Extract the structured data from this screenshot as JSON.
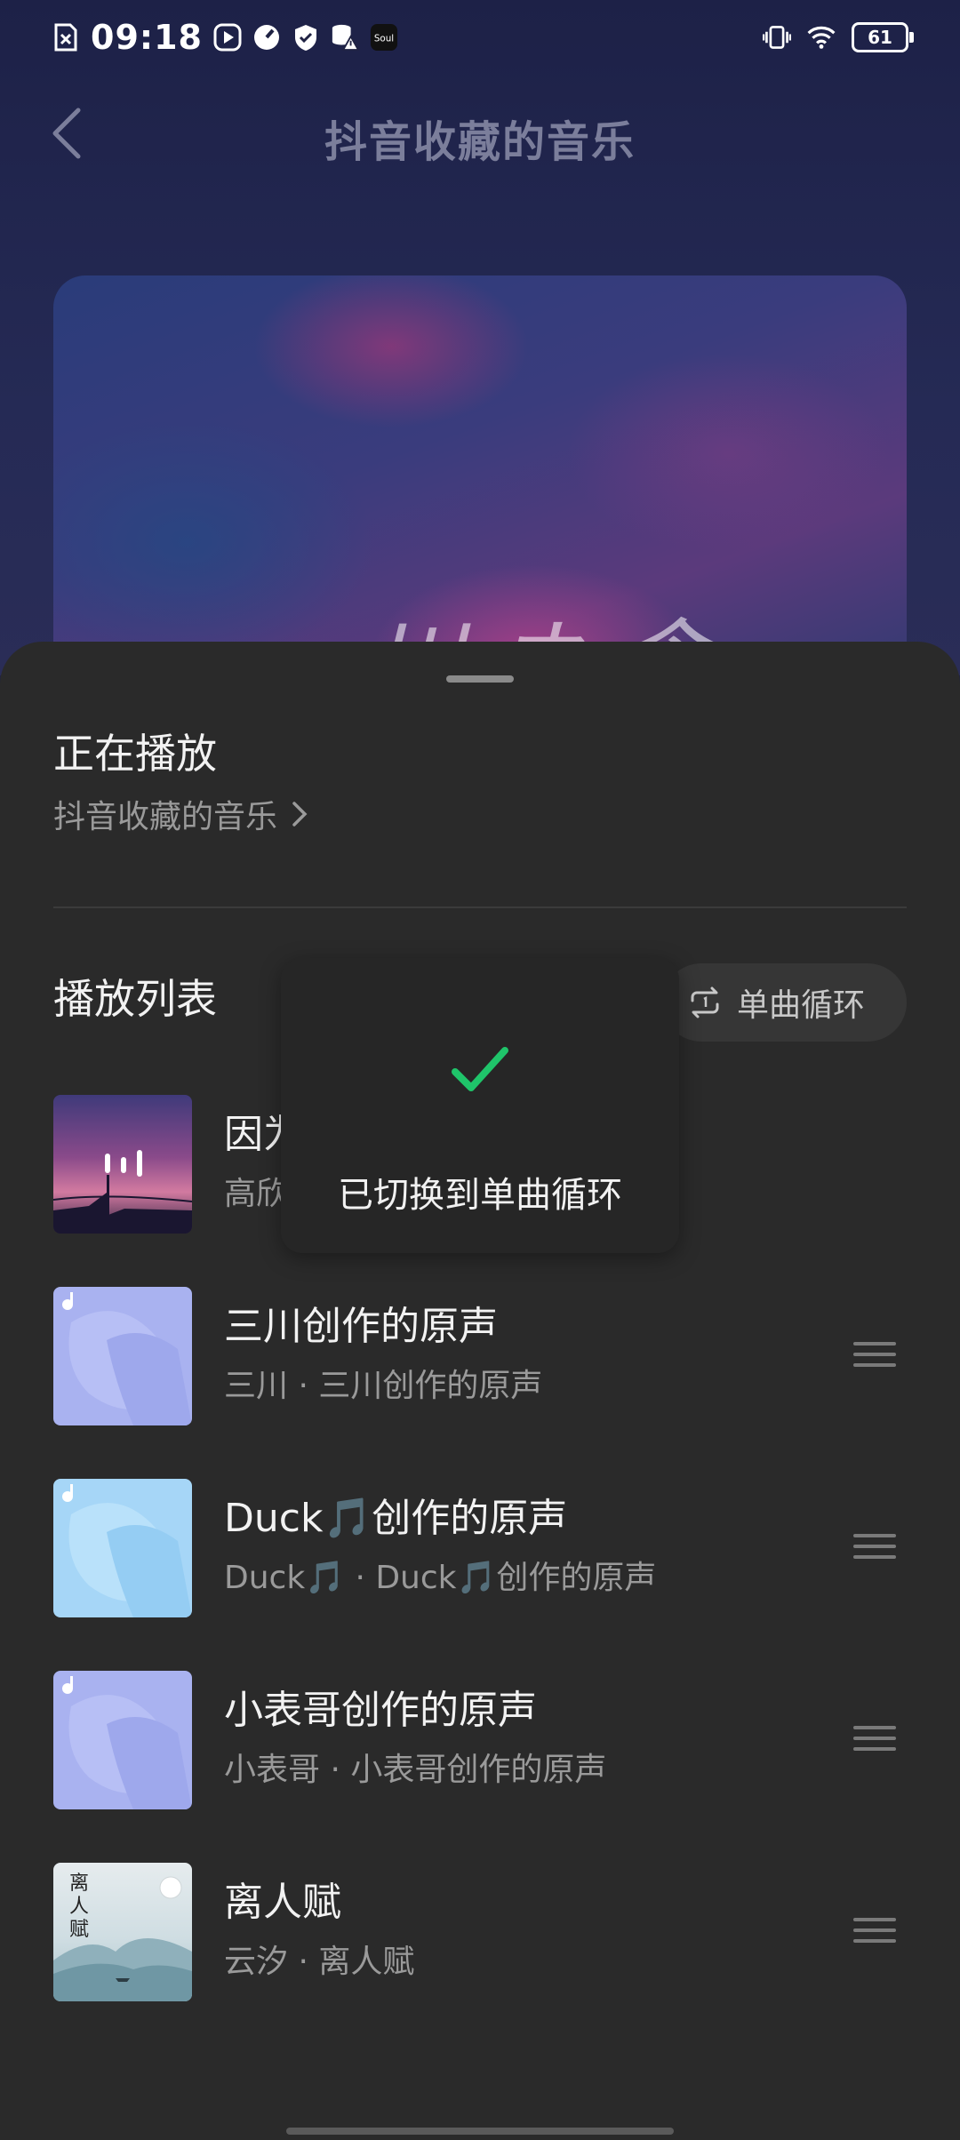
{
  "status_bar": {
    "time": "09:18",
    "battery": "61",
    "left_icons": [
      "close-box-icon",
      "play-icon",
      "speed-icon",
      "shield-icon",
      "database-warning-icon",
      "soul-app-icon"
    ],
    "right_icons": [
      "vibrate-icon",
      "wifi-icon",
      "battery-icon"
    ]
  },
  "header": {
    "title": "抖音收藏的音乐",
    "back_icon": "chevron-left-icon"
  },
  "cover": {
    "script_text": "一川ネ念"
  },
  "sheet": {
    "now_playing_label": "正在播放",
    "source_name": "抖音收藏的音乐",
    "playlist_label": "播放列表",
    "loop_mode_label": "单曲循环"
  },
  "songs": [
    {
      "title": "因为",
      "subtitle": "高欣",
      "thumb": "sunset-bridge",
      "playing": true
    },
    {
      "title": "三川创作的原声",
      "subtitle": "三川 · 三川创作的原声",
      "thumb": "blue-music"
    },
    {
      "title": "Duck🎵创作的原声",
      "subtitle": "Duck🎵 · Duck🎵创作的原声",
      "thumb": "lightblue-music"
    },
    {
      "title": "小表哥创作的原声",
      "subtitle": "小表哥 · 小表哥创作的原声",
      "thumb": "blue-music"
    },
    {
      "title": "离人赋",
      "subtitle": "云汐 · 离人赋",
      "thumb": "ink-landscape"
    }
  ],
  "toast": {
    "message": "已切换到单曲循环",
    "icon": "check-icon"
  },
  "colors": {
    "accent_green": "#1fc46a",
    "sheet_bg": "#2a2a2a",
    "header_bg": "#1f2243"
  }
}
